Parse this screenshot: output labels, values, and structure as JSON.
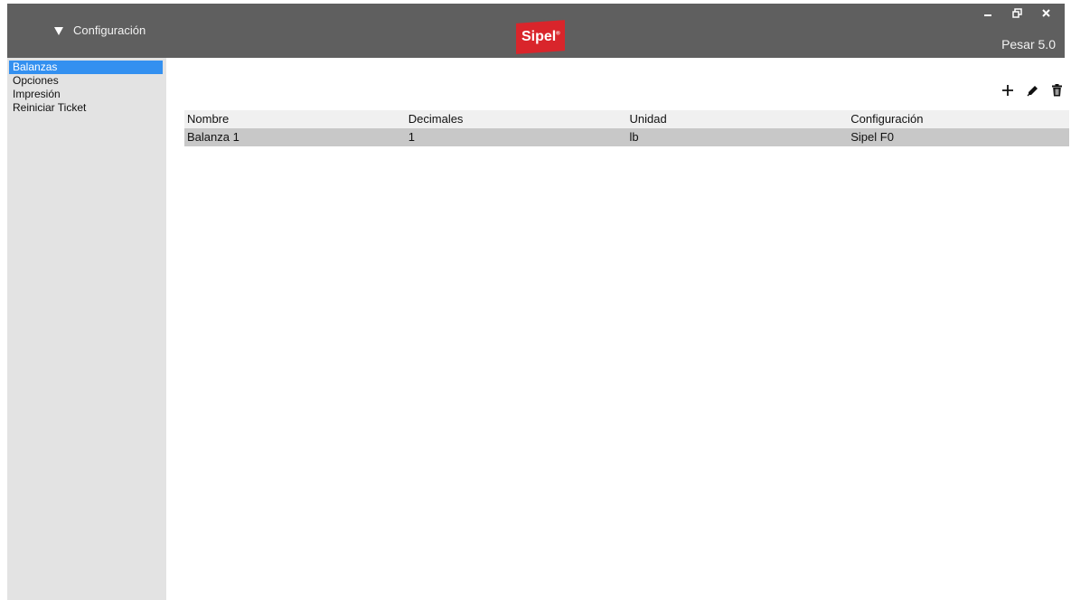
{
  "header": {
    "menu_label": "Configuración",
    "logo_text": "Sipel",
    "logo_mark": "®",
    "version": "Pesar 5.0",
    "colors": {
      "titlebar": "#5f5f5f",
      "logo": "#d9252b",
      "accent": "#3390f0"
    }
  },
  "window_controls": [
    "minimize-icon",
    "restore-icon",
    "close-icon"
  ],
  "sidebar": {
    "items": [
      {
        "label": "Balanzas",
        "active": true
      },
      {
        "label": "Opciones",
        "active": false
      },
      {
        "label": "Impresión",
        "active": false
      },
      {
        "label": "Reiniciar Ticket",
        "active": false
      }
    ]
  },
  "toolbar": {
    "icons": [
      "add-icon",
      "edit-icon",
      "delete-icon"
    ]
  },
  "table": {
    "columns": [
      "Nombre",
      "Decimales",
      "Unidad",
      "Configuración"
    ],
    "rows": [
      [
        "Balanza 1",
        "1",
        "lb",
        "Sipel F0"
      ]
    ]
  }
}
